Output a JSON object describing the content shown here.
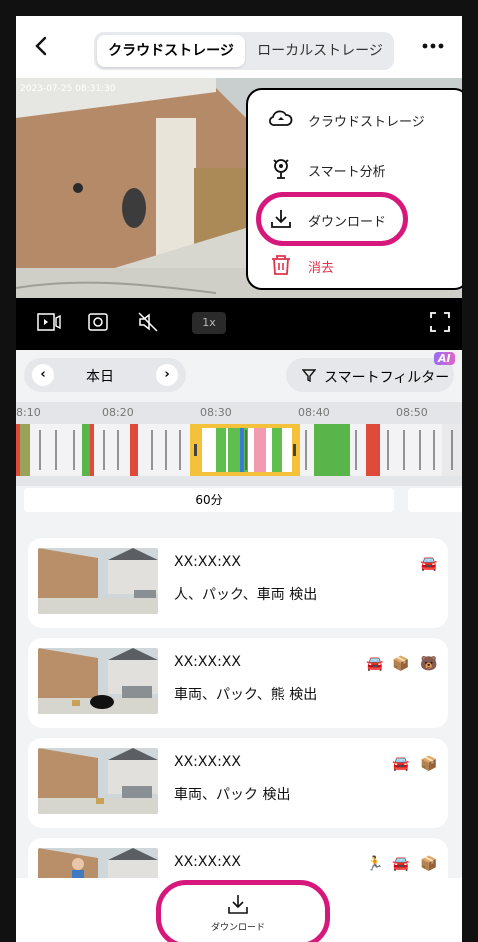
{
  "header": {
    "tabs": [
      {
        "label": "クラウドストレージ",
        "active": true
      },
      {
        "label": "ローカルストレージ",
        "active": false
      }
    ]
  },
  "video": {
    "timestamp": "2023-07-25 08:31:30",
    "speed": "1x"
  },
  "menu": {
    "items": [
      {
        "label": "クラウドストレージ",
        "icon": "cloud-icon"
      },
      {
        "label": "スマート分析",
        "icon": "smart-analysis-icon"
      },
      {
        "label": "ダウンロード",
        "icon": "download-icon"
      },
      {
        "label": "消去",
        "icon": "trash-icon",
        "color": "#e0344d"
      }
    ]
  },
  "date": {
    "label": "本日"
  },
  "filter": {
    "label": "スマートフィルター",
    "badge": "AI"
  },
  "timeline": {
    "ticks": [
      "8:10",
      "08:20",
      "08:30",
      "08:40",
      "08:50"
    ],
    "duration": "60分"
  },
  "events": [
    {
      "time": "XX:XX:XX",
      "desc": "人、パック、車両 検出",
      "icons": [
        "car-icon"
      ]
    },
    {
      "time": "XX:XX:XX",
      "desc": "車両、パック、熊 検出",
      "icons": [
        "car-icon",
        "package-icon",
        "animal-icon"
      ]
    },
    {
      "time": "XX:XX:XX",
      "desc": "車両、パック 検出",
      "icons": [
        "car-icon",
        "package-icon"
      ]
    },
    {
      "time": "XX:XX:XX",
      "desc": "",
      "icons": [
        "person-icon",
        "car-icon",
        "package-icon"
      ]
    }
  ],
  "bottom": {
    "download_label": "ダウンロード"
  },
  "colors": {
    "accent_ring": "#d6177c",
    "danger": "#e0344d"
  }
}
